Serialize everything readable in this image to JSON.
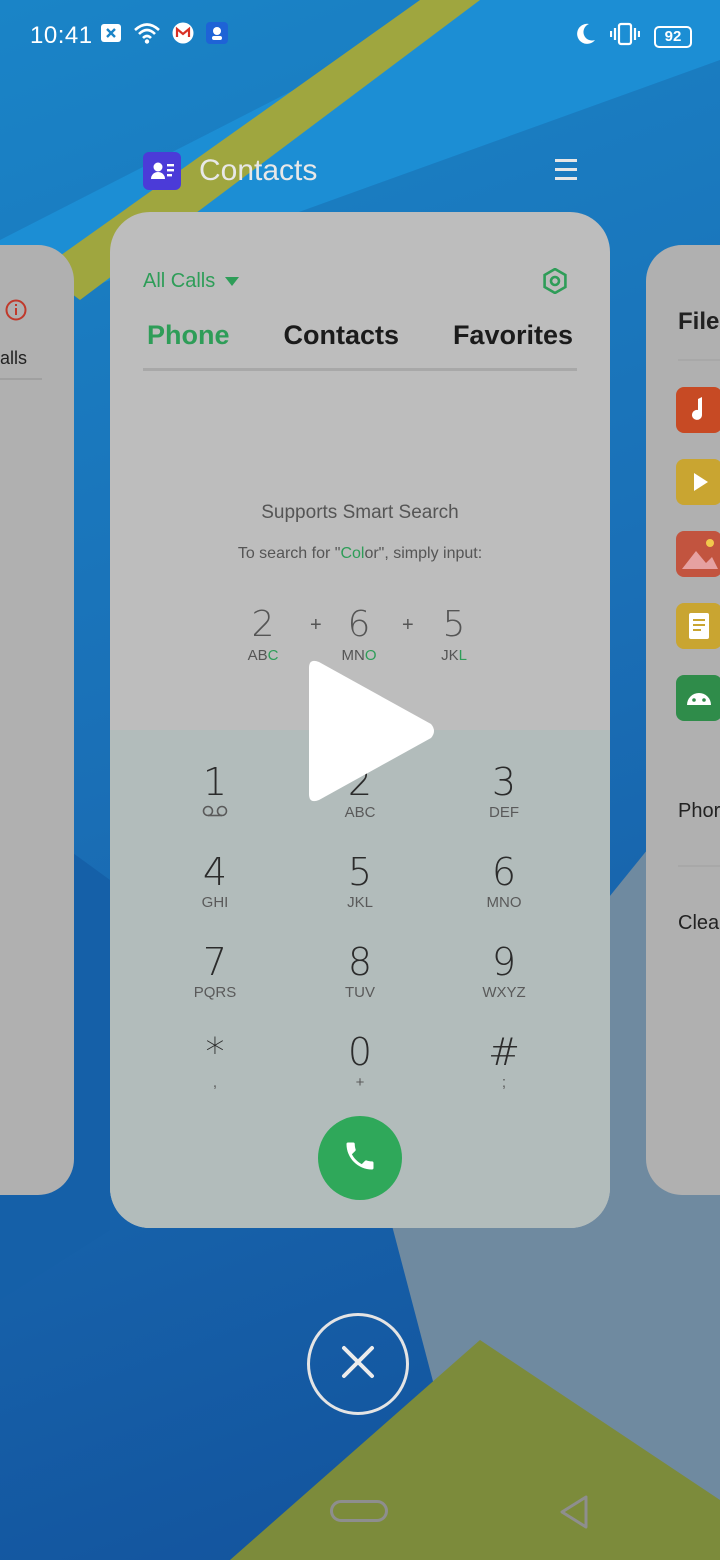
{
  "status_bar": {
    "time": "10:41",
    "battery": "92",
    "left_icons": [
      "blocked-notification-icon",
      "wifi-icon",
      "gmail-icon",
      "app-notification-icon"
    ],
    "right_icons": [
      "do-not-disturb-moon-icon",
      "vibrate-icon",
      "battery-icon"
    ]
  },
  "recent_app": {
    "name": "Contacts",
    "icon": "contacts-app-icon",
    "menu_icon": "hamburger-menu-icon"
  },
  "dialer": {
    "filter_label": "All Calls",
    "tabs": [
      {
        "label": "Phone",
        "active": true
      },
      {
        "label": "Contacts",
        "active": false
      },
      {
        "label": "Favorites",
        "active": false
      }
    ],
    "smart_search_title": "Supports Smart Search",
    "smart_search_prefix": "To search for \"",
    "smart_search_highlight": "Col",
    "smart_search_rest": "or\", simply input:",
    "example_keys": [
      {
        "digit": "2",
        "letters_plain": "AB",
        "letters_hl": "C"
      },
      {
        "digit": "6",
        "letters_plain": "MN",
        "letters_hl": "O"
      },
      {
        "digit": "5",
        "letters_plain": "JK",
        "letters_hl": "L"
      }
    ],
    "plus": "+",
    "keypad": [
      {
        "digit": "1",
        "letters": ""
      },
      {
        "digit": "2",
        "letters": "ABC"
      },
      {
        "digit": "3",
        "letters": "DEF"
      },
      {
        "digit": "4",
        "letters": "GHI"
      },
      {
        "digit": "5",
        "letters": "JKL"
      },
      {
        "digit": "6",
        "letters": "MNO"
      },
      {
        "digit": "7",
        "letters": "PQRS"
      },
      {
        "digit": "8",
        "letters": "TUV"
      },
      {
        "digit": "9",
        "letters": "WXYZ"
      },
      {
        "digit": "*",
        "letters": ","
      },
      {
        "digit": "0",
        "letters": "+"
      },
      {
        "digit": "#",
        "letters": ";"
      }
    ]
  },
  "side_left": {
    "text": "alls"
  },
  "side_right": {
    "title": "File",
    "item_1": "Phor",
    "item_2": "Clear"
  },
  "colors": {
    "accent": "#2e9d58",
    "card": "#bdbdbd",
    "keypad": "#b2bcbb",
    "call_button": "#2fa85a"
  }
}
